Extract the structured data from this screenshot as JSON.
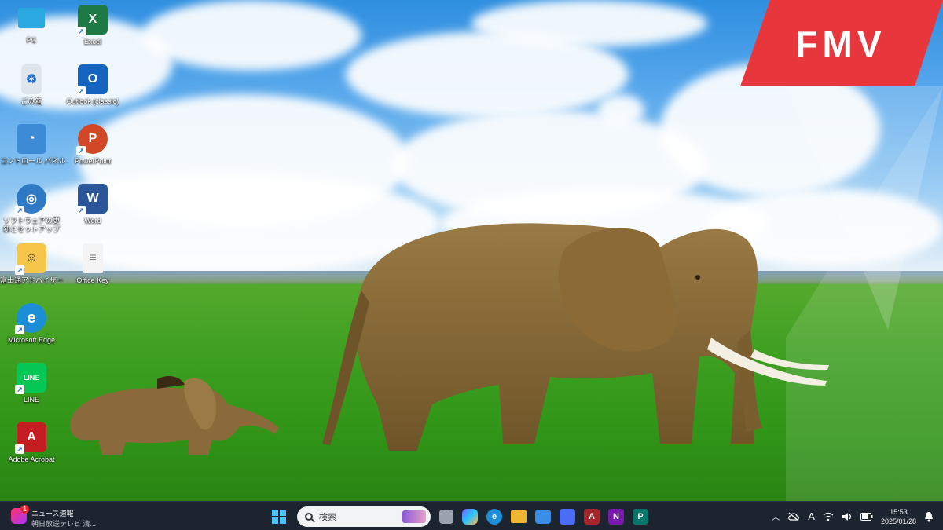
{
  "desktop": {
    "brand_logo": "FMV",
    "icons": [
      {
        "name": "pc-icon",
        "label": "PC",
        "color": "#2aa8e0",
        "glyph": "",
        "shortcut": false
      },
      {
        "name": "excel-icon",
        "label": "Excel",
        "color": "#1d7a45",
        "glyph": "X",
        "shortcut": true
      },
      {
        "name": "recycle-bin-icon",
        "label": "ごみ箱",
        "color": "#dfe6ee",
        "glyph": "♻",
        "shortcut": false
      },
      {
        "name": "outlook-icon",
        "label": "Outlook (classic)",
        "color": "#1565c0",
        "glyph": "O",
        "shortcut": true
      },
      {
        "name": "control-panel-icon",
        "label": "コントロール パネル",
        "color": "#3d8ad6",
        "glyph": "◔",
        "shortcut": false
      },
      {
        "name": "powerpoint-icon",
        "label": "PowerPoint",
        "color": "#d24726",
        "glyph": "P",
        "shortcut": true
      },
      {
        "name": "software-update-icon",
        "label": "ソフトウェアの更新とセットアップ",
        "color": "#2f78c4",
        "glyph": "◎",
        "shortcut": true
      },
      {
        "name": "word-icon",
        "label": "Word",
        "color": "#2b579a",
        "glyph": "W",
        "shortcut": true
      },
      {
        "name": "fujitsu-navi-icon",
        "label": "富士通アドバイザー",
        "color": "#f6c64a",
        "glyph": "☺",
        "shortcut": true
      },
      {
        "name": "office-key-icon",
        "label": "Office Key",
        "color": "#f4f4f4",
        "glyph": "≡",
        "shortcut": false
      },
      {
        "name": "edge-icon",
        "label": "Microsoft Edge",
        "color": "#1b8ed6",
        "glyph": "e",
        "shortcut": true
      },
      {
        "name": "line-icon",
        "label": "LINE",
        "color": "#06c755",
        "glyph": "LINE",
        "shortcut": true
      },
      {
        "name": "acrobat-icon",
        "label": "Adobe Acrobat",
        "color": "#c51d22",
        "glyph": "A",
        "shortcut": true
      }
    ]
  },
  "taskbar": {
    "news": {
      "badge": "1",
      "title": "ニュース速報",
      "subtitle": "朝日放送テレビ 清..."
    },
    "search_placeholder": "検索",
    "apps": [
      {
        "name": "task-view-icon",
        "color": "#9aa3ad",
        "glyph": "▭"
      },
      {
        "name": "copilot-icon",
        "color": "#7b61ff",
        "glyph": "✦"
      },
      {
        "name": "edge-taskbar-icon",
        "color": "#1b8ed6",
        "glyph": "e"
      },
      {
        "name": "file-explorer-icon",
        "color": "#f2b632",
        "glyph": "▬"
      },
      {
        "name": "store-icon",
        "color": "#3a8ee6",
        "glyph": "▦"
      },
      {
        "name": "calendar-app-icon",
        "color": "#4a6cf7",
        "glyph": "▣"
      },
      {
        "name": "access-icon",
        "color": "#a4262c",
        "glyph": "A"
      },
      {
        "name": "onenote-icon",
        "color": "#7719aa",
        "glyph": "N"
      },
      {
        "name": "publisher-icon",
        "color": "#077568",
        "glyph": "P"
      }
    ],
    "tray": {
      "ime": "A",
      "time": "15:53",
      "date": "2025/01/28"
    }
  }
}
